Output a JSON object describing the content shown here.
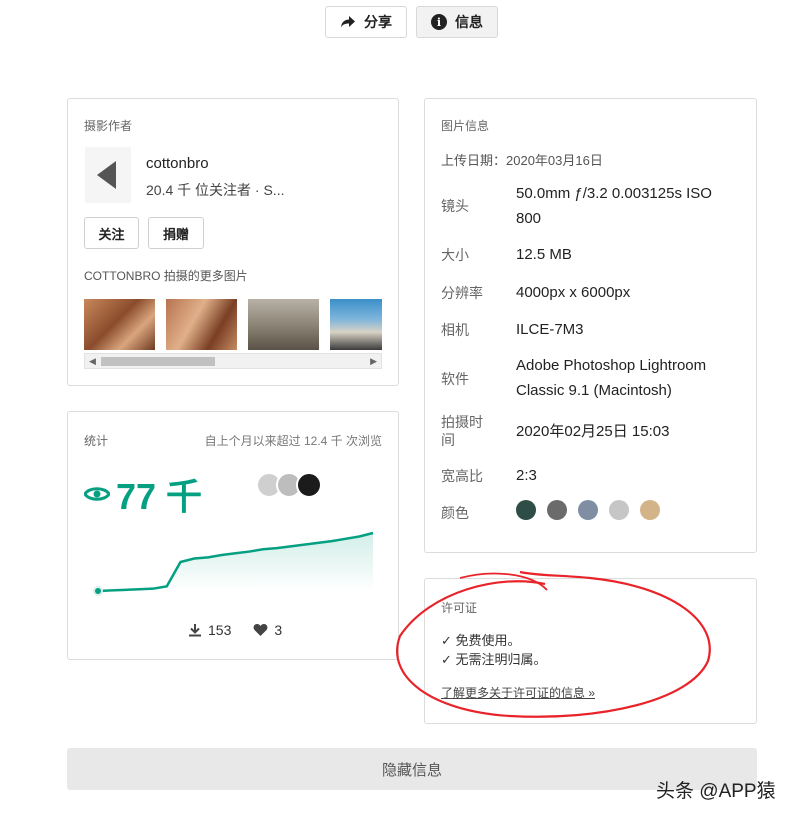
{
  "toolbar": {
    "share_label": "分享",
    "info_label": "信息"
  },
  "author": {
    "section_title": "摄影作者",
    "name": "cottonbro",
    "followers": "20.4 千 位关注者 · S...",
    "follow_label": "关注",
    "donate_label": "捐赠",
    "more_title": "COTTONBRO 拍摄的更多图片"
  },
  "image_info": {
    "section_title": "图片信息",
    "upload_date": "上传日期：2020年03月16日",
    "rows": [
      {
        "label": "镜头",
        "value": "50.0mm ƒ/3.2 0.003125s ISO 800"
      },
      {
        "label": "大小",
        "value": "12.5 MB"
      },
      {
        "label": "分辨率",
        "value": "4000px x 6000px"
      },
      {
        "label": "相机",
        "value": "ILCE-7M3"
      },
      {
        "label": "软件",
        "value": "Adobe Photoshop Lightroom Classic 9.1 (Macintosh)"
      },
      {
        "label": "拍摄时间",
        "value": "2020年02月25日 15:03"
      },
      {
        "label": "宽高比",
        "value": "2:3"
      },
      {
        "label": "颜色",
        "value": ""
      }
    ],
    "colors": [
      "#2d4d46",
      "#6b6b6b",
      "#7f8ea3",
      "#c6c6c6",
      "#d3b489"
    ]
  },
  "stats": {
    "section_title": "统计",
    "subtitle": "自上个月以来超过 12.4 千 次浏览",
    "views": "77 千",
    "downloads": "153",
    "likes": "3",
    "accent_color": "#05a081"
  },
  "chart_data": {
    "type": "area",
    "x": [
      0,
      1,
      2,
      3,
      4,
      5,
      6,
      7,
      8,
      9,
      10,
      11,
      12,
      13,
      14,
      15,
      16,
      17,
      18,
      19,
      20
    ],
    "y": [
      0.0,
      0.01,
      0.02,
      0.03,
      0.04,
      0.08,
      0.5,
      0.56,
      0.58,
      0.62,
      0.65,
      0.68,
      0.72,
      0.74,
      0.77,
      0.8,
      0.83,
      0.86,
      0.9,
      0.94,
      1.0
    ],
    "ylim": [
      0,
      1
    ]
  },
  "license": {
    "section_title": "许可证",
    "line1": "✓ 免费使用。",
    "line2": "✓ 无需注明归属。",
    "link": "了解更多关于许可证的信息 »"
  },
  "footer": {
    "hide_label": "隐藏信息"
  },
  "watermark": "头条 @APP猿"
}
